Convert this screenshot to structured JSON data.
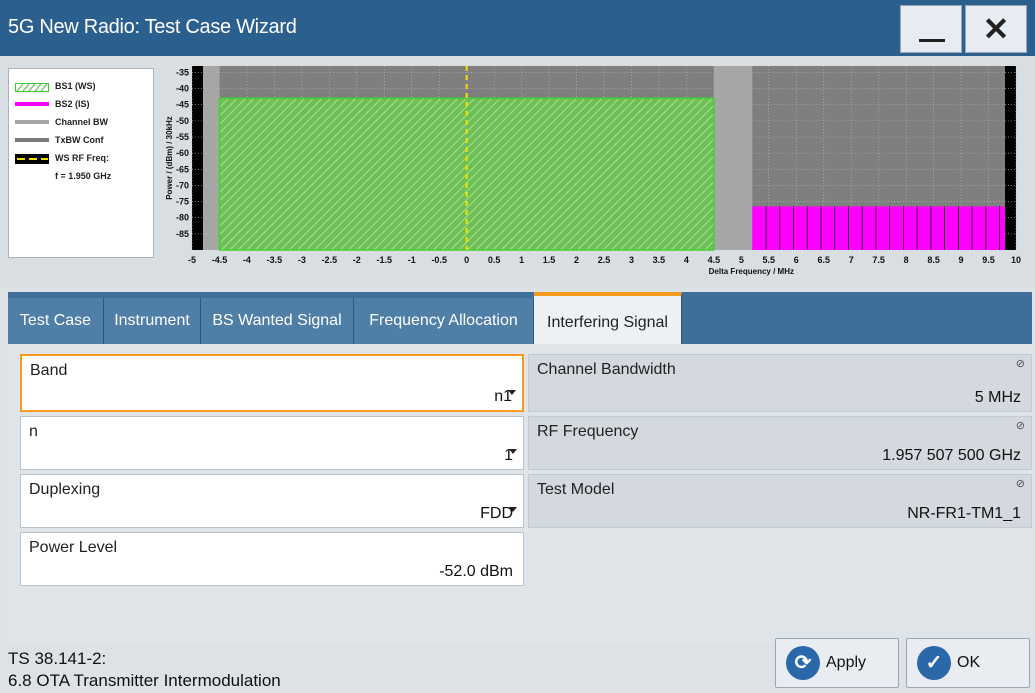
{
  "window": {
    "title": "5G New Radio: Test Case Wizard"
  },
  "legend": {
    "items": [
      {
        "label": "BS1 (WS)",
        "color": "#44c33a"
      },
      {
        "label": "BS2 (IS)",
        "color": "#ff00ff"
      },
      {
        "label": "Channel BW",
        "color": "#a6a6a6"
      },
      {
        "label": "TxBW Conf",
        "color": "#7a7a7a"
      },
      {
        "label": "WS RF Freq:",
        "color": "#f2e200"
      }
    ],
    "freq_note": "f = 1.950 GHz"
  },
  "chart_data": {
    "type": "area",
    "xlabel": "Delta Frequency / MHz",
    "ylabel": "Power / (dBm) / 30kHz",
    "x_ticks": [
      "-5",
      "-4.5",
      "-4",
      "-3.5",
      "-3",
      "-2.5",
      "-2",
      "-1.5",
      "-1",
      "-0.5",
      "0",
      "0.5",
      "1",
      "1.5",
      "2",
      "2.5",
      "3",
      "3.5",
      "4",
      "4.5",
      "5",
      "5.5",
      "6",
      "6.5",
      "7",
      "7.5",
      "8",
      "8.5",
      "9",
      "9.5",
      "10"
    ],
    "y_ticks": [
      "-35",
      "-40",
      "-45",
      "-50",
      "-55",
      "-60",
      "-65",
      "-70",
      "-75",
      "-80",
      "-85"
    ],
    "xlim": [
      -5,
      10
    ],
    "ylim": [
      -90,
      -33
    ],
    "series": [
      {
        "name": "BS1 (WS)",
        "x_range": [
          -4.5,
          4.5
        ],
        "level": -43
      },
      {
        "name": "BS2 (IS)",
        "x_range": [
          5.2,
          9.8
        ],
        "level": -76.5
      }
    ],
    "ws_rf_freq_marker": 0
  },
  "tabs": [
    {
      "label": "Test Case"
    },
    {
      "label": "Instrument"
    },
    {
      "label": "BS Wanted Signal"
    },
    {
      "label": "Frequency Allocation"
    },
    {
      "label": "Interfering Signal"
    }
  ],
  "fields": {
    "band": {
      "label": "Band",
      "value": "n1"
    },
    "n": {
      "label": "n",
      "value": "1"
    },
    "duplexing": {
      "label": "Duplexing",
      "value": "FDD"
    },
    "power_level": {
      "label": "Power Level",
      "value": "-52.0 dBm"
    },
    "channel_bandwidth": {
      "label": "Channel Bandwidth",
      "value": "5 MHz"
    },
    "rf_frequency": {
      "label": "RF Frequency",
      "value": "1.957 507 500 GHz"
    },
    "test_model": {
      "label": "Test Model",
      "value": "NR-FR1-TM1_1"
    }
  },
  "footer": {
    "line1": "TS 38.141-2:",
    "line2": "6.8 OTA Transmitter Intermodulation",
    "apply_label": "Apply",
    "ok_label": "OK"
  },
  "colors": {
    "accent": "#f39c1e",
    "titlebar": "#2b5f8e"
  }
}
